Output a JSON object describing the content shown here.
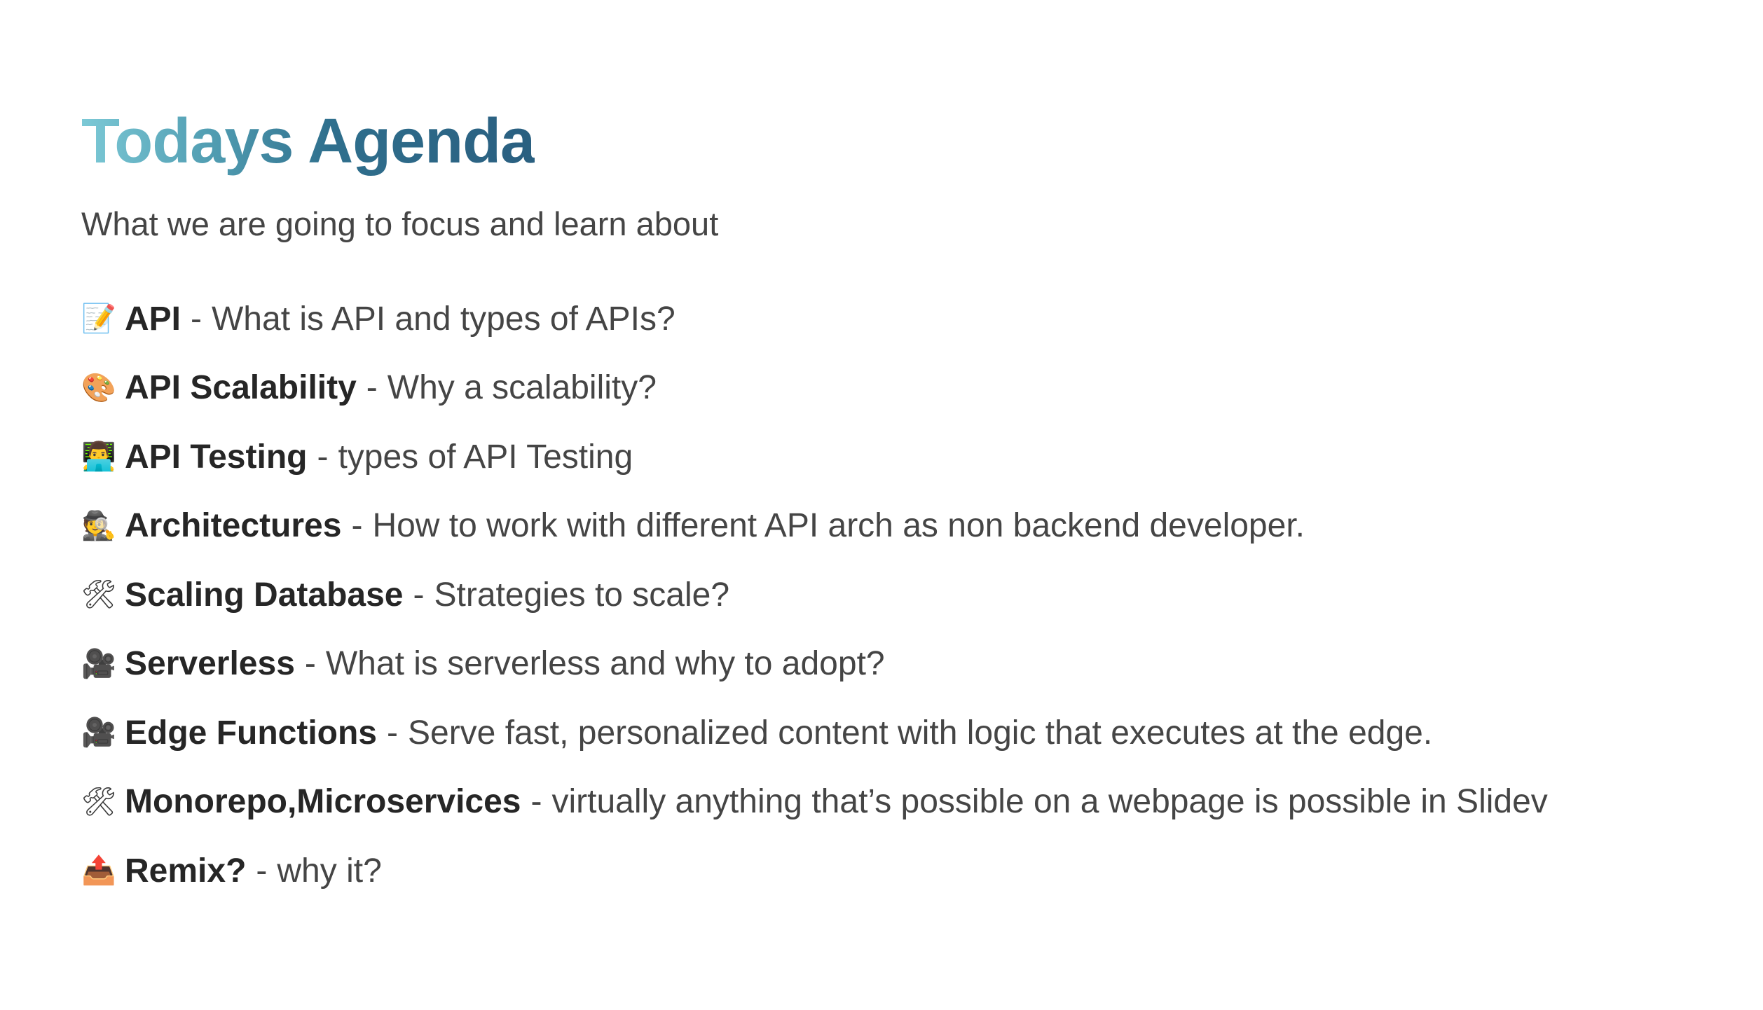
{
  "slide": {
    "title": "Todays Agenda",
    "subtitle": "What we are going to focus and learn about",
    "separator": "-",
    "items": [
      {
        "icon": "memo-icon",
        "emoji": "📝",
        "name": "API",
        "description": "What is API and types of APIs?"
      },
      {
        "icon": "palette-icon",
        "emoji": "🎨",
        "name": "API Scalability",
        "description": "Why a scalability?"
      },
      {
        "icon": "technologist-icon",
        "emoji": "👨‍💻",
        "name": "API Testing",
        "description": "types of API Testing"
      },
      {
        "icon": "detective-icon",
        "emoji": "🕵",
        "name": "Architectures",
        "description": "How to work with different API arch as non backend developer."
      },
      {
        "icon": "hammer-wrench-icon",
        "emoji": "🛠",
        "name": "Scaling Database",
        "description": "Strategies to scale?"
      },
      {
        "icon": "movie-camera-icon",
        "emoji": "🎥",
        "name": "Serverless",
        "description": "What is serverless and why to adopt?"
      },
      {
        "icon": "movie-camera-icon",
        "emoji": "🎥",
        "name": "Edge Functions",
        "description": "Serve fast, personalized content with logic that executes at the edge."
      },
      {
        "icon": "hammer-wrench-icon",
        "emoji": "🛠",
        "name": "Monorepo,Microservices",
        "description": "virtually anything that’s possible on a webpage is possible in Slidev"
      },
      {
        "icon": "outbox-tray-icon",
        "emoji": "📤",
        "name": "Remix?",
        "description": "why it?"
      }
    ]
  }
}
